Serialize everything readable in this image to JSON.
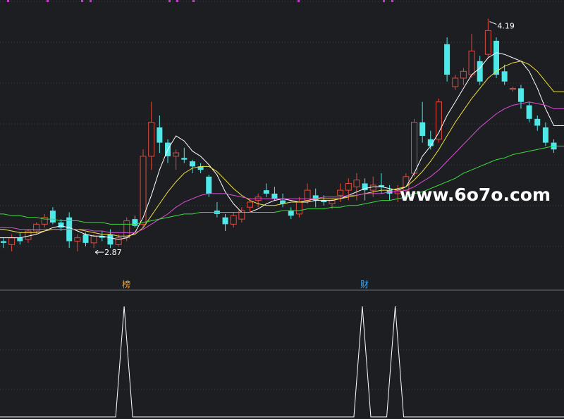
{
  "chart_data": [
    {
      "type": "candlestick",
      "title": "",
      "xlabel": "",
      "ylabel": "",
      "grid": true,
      "price_range": [
        2.6,
        4.3
      ],
      "series": [
        {
          "name": "",
          "kind": "ohlc",
          "values": [
            [
              2.88,
              2.9,
              2.84,
              2.87
            ],
            [
              2.86,
              2.92,
              2.82,
              2.9
            ],
            [
              2.9,
              2.93,
              2.86,
              2.88
            ],
            [
              2.89,
              2.95,
              2.87,
              2.94
            ],
            [
              2.94,
              2.99,
              2.92,
              2.98
            ],
            [
              2.98,
              3.04,
              2.96,
              3.02
            ],
            [
              3.06,
              3.08,
              2.98,
              2.99
            ],
            [
              2.99,
              3.01,
              2.94,
              2.96
            ],
            [
              3.02,
              3.05,
              2.84,
              2.88
            ],
            [
              2.88,
              2.92,
              2.82,
              2.9
            ],
            [
              2.92,
              2.93,
              2.85,
              2.87
            ],
            [
              2.87,
              2.92,
              2.84,
              2.91
            ],
            [
              2.91,
              2.94,
              2.88,
              2.9
            ],
            [
              2.92,
              2.95,
              2.84,
              2.86
            ],
            [
              2.86,
              2.92,
              2.85,
              2.9
            ],
            [
              2.9,
              3.02,
              2.88,
              3.0
            ],
            [
              3.01,
              3.03,
              2.96,
              2.97
            ],
            [
              2.98,
              3.42,
              2.96,
              3.38
            ],
            [
              3.38,
              3.7,
              3.3,
              3.58
            ],
            [
              3.55,
              3.62,
              3.4,
              3.46
            ],
            [
              3.46,
              3.48,
              3.34,
              3.38
            ],
            [
              3.38,
              3.42,
              3.3,
              3.4
            ],
            [
              3.37,
              3.43,
              3.34,
              3.36
            ],
            [
              3.35,
              3.36,
              3.28,
              3.32
            ],
            [
              3.32,
              3.34,
              3.28,
              3.3
            ],
            [
              3.26,
              3.27,
              3.14,
              3.16
            ],
            [
              3.06,
              3.11,
              3.02,
              3.04
            ],
            [
              3.02,
              3.04,
              2.94,
              2.98
            ],
            [
              2.98,
              3.05,
              2.96,
              3.03
            ],
            [
              3.01,
              3.08,
              2.99,
              3.06
            ],
            [
              3.08,
              3.13,
              3.05,
              3.11
            ],
            [
              3.12,
              3.16,
              3.08,
              3.14
            ],
            [
              3.18,
              3.22,
              3.14,
              3.16
            ],
            [
              3.16,
              3.2,
              3.12,
              3.13
            ],
            [
              3.12,
              3.16,
              3.08,
              3.1
            ],
            [
              3.06,
              3.08,
              3.01,
              3.03
            ],
            [
              3.04,
              3.14,
              3.02,
              3.11
            ],
            [
              3.12,
              3.22,
              3.1,
              3.18
            ],
            [
              3.15,
              3.19,
              3.08,
              3.12
            ],
            [
              3.12,
              3.15,
              3.09,
              3.11
            ],
            [
              3.1,
              3.13,
              3.07,
              3.12
            ],
            [
              3.15,
              3.22,
              3.11,
              3.18
            ],
            [
              3.18,
              3.25,
              3.12,
              3.22
            ],
            [
              3.2,
              3.28,
              3.12,
              3.24
            ],
            [
              3.22,
              3.25,
              3.12,
              3.18
            ],
            [
              3.18,
              3.26,
              3.14,
              3.21
            ],
            [
              3.21,
              3.28,
              3.16,
              3.2
            ],
            [
              3.18,
              3.21,
              3.12,
              3.16
            ],
            [
              3.16,
              3.21,
              3.11,
              3.18
            ],
            [
              3.18,
              3.28,
              3.16,
              3.26
            ],
            [
              3.28,
              3.6,
              3.26,
              3.58
            ],
            [
              3.58,
              3.7,
              3.46,
              3.5
            ],
            [
              3.48,
              3.53,
              3.42,
              3.44
            ],
            [
              3.48,
              3.72,
              3.46,
              3.7
            ],
            [
              4.04,
              4.08,
              3.82,
              3.86
            ],
            [
              3.79,
              3.86,
              3.77,
              3.84
            ],
            [
              3.84,
              3.9,
              3.8,
              3.88
            ],
            [
              3.86,
              4.1,
              3.84,
              4.0
            ],
            [
              3.94,
              3.97,
              3.8,
              3.82
            ],
            [
              3.98,
              4.19,
              3.96,
              4.12
            ],
            [
              4.06,
              4.08,
              3.84,
              3.86
            ],
            [
              3.88,
              3.92,
              3.8,
              3.82
            ],
            [
              3.78,
              3.79,
              3.76,
              3.78
            ],
            [
              3.78,
              3.8,
              3.66,
              3.7
            ],
            [
              3.68,
              3.7,
              3.58,
              3.6
            ],
            [
              3.6,
              3.62,
              3.53,
              3.56
            ],
            [
              3.55,
              3.58,
              3.44,
              3.46
            ],
            [
              3.46,
              3.48,
              3.4,
              3.42
            ]
          ]
        },
        {
          "name": "",
          "kind": "ma",
          "color": "#ffffff",
          "values": [
            2.9,
            2.9,
            2.9,
            2.91,
            2.92,
            2.94,
            2.96,
            2.97,
            2.96,
            2.94,
            2.92,
            2.91,
            2.91,
            2.9,
            2.89,
            2.9,
            2.93,
            3.02,
            3.15,
            3.3,
            3.42,
            3.5,
            3.47,
            3.41,
            3.38,
            3.33,
            3.27,
            3.17,
            3.1,
            3.05,
            3.05,
            3.07,
            3.1,
            3.12,
            3.13,
            3.12,
            3.11,
            3.11,
            3.12,
            3.12,
            3.12,
            3.13,
            3.15,
            3.17,
            3.19,
            3.2,
            3.2,
            3.19,
            3.18,
            3.2,
            3.28,
            3.38,
            3.44,
            3.52,
            3.62,
            3.7,
            3.78,
            3.86,
            3.9,
            3.96,
            3.99,
            3.98,
            3.96,
            3.94,
            3.88,
            3.78,
            3.66,
            3.56
          ]
        },
        {
          "name": "",
          "kind": "ma",
          "color": "#f0e03c",
          "values": [
            2.95,
            2.94,
            2.93,
            2.93,
            2.93,
            2.94,
            2.95,
            2.95,
            2.95,
            2.95,
            2.94,
            2.93,
            2.92,
            2.92,
            2.91,
            2.91,
            2.92,
            2.96,
            3.03,
            3.1,
            3.17,
            3.23,
            3.28,
            3.31,
            3.32,
            3.32,
            3.29,
            3.24,
            3.19,
            3.15,
            3.12,
            3.1,
            3.09,
            3.09,
            3.1,
            3.11,
            3.11,
            3.12,
            3.13,
            3.13,
            3.13,
            3.13,
            3.14,
            3.15,
            3.16,
            3.17,
            3.18,
            3.18,
            3.19,
            3.2,
            3.24,
            3.29,
            3.35,
            3.42,
            3.5,
            3.58,
            3.65,
            3.72,
            3.78,
            3.84,
            3.88,
            3.91,
            3.93,
            3.94,
            3.92,
            3.88,
            3.82,
            3.76
          ]
        },
        {
          "name": "",
          "kind": "ma",
          "color": "#d94fd4",
          "values": [
            2.96,
            2.96,
            2.95,
            2.95,
            2.95,
            2.95,
            2.95,
            2.95,
            2.95,
            2.95,
            2.95,
            2.94,
            2.94,
            2.93,
            2.93,
            2.93,
            2.93,
            2.95,
            2.98,
            3.01,
            3.04,
            3.08,
            3.11,
            3.13,
            3.15,
            3.16,
            3.16,
            3.16,
            3.15,
            3.14,
            3.13,
            3.13,
            3.13,
            3.13,
            3.13,
            3.13,
            3.13,
            3.13,
            3.13,
            3.14,
            3.14,
            3.14,
            3.15,
            3.15,
            3.16,
            3.16,
            3.16,
            3.17,
            3.17,
            3.18,
            3.2,
            3.23,
            3.26,
            3.3,
            3.35,
            3.4,
            3.45,
            3.5,
            3.55,
            3.59,
            3.63,
            3.66,
            3.68,
            3.69,
            3.7,
            3.69,
            3.68,
            3.66
          ]
        },
        {
          "name": "",
          "kind": "ma",
          "color": "#3cdc3c",
          "values": [
            3.04,
            3.03,
            3.03,
            3.02,
            3.02,
            3.01,
            3.01,
            3.0,
            3.0,
            3.0,
            2.99,
            2.99,
            2.99,
            2.98,
            2.98,
            2.98,
            2.98,
            2.99,
            3.0,
            3.01,
            3.02,
            3.03,
            3.04,
            3.04,
            3.05,
            3.05,
            3.05,
            3.05,
            3.05,
            3.05,
            3.05,
            3.05,
            3.05,
            3.05,
            3.06,
            3.06,
            3.06,
            3.07,
            3.07,
            3.07,
            3.08,
            3.08,
            3.09,
            3.09,
            3.1,
            3.11,
            3.12,
            3.12,
            3.13,
            3.14,
            3.16,
            3.17,
            3.19,
            3.21,
            3.23,
            3.25,
            3.28,
            3.3,
            3.32,
            3.34,
            3.36,
            3.37,
            3.39,
            3.4,
            3.41,
            3.42,
            3.43,
            3.44
          ]
        }
      ],
      "annotations": [
        {
          "label": "2.87",
          "kind": "low",
          "index": 11
        },
        {
          "label": "4.19",
          "kind": "high",
          "index": 59
        },
        {
          "label": "榜",
          "kind": "event",
          "index": 14
        },
        {
          "label": "财",
          "kind": "event",
          "index": 43
        }
      ],
      "watermark": "www.6o7o.com"
    },
    {
      "type": "line",
      "title": "",
      "xlabel": "",
      "ylabel": "",
      "ylim": [
        0,
        1
      ],
      "series": [
        {
          "name": "",
          "color": "#ffffff",
          "values": [
            0,
            0,
            0,
            0,
            0,
            0,
            0,
            0,
            0,
            0,
            0,
            0,
            0,
            0,
            1,
            0,
            0,
            0,
            0,
            0,
            0,
            0,
            0,
            0,
            0,
            0,
            0,
            0,
            0,
            0,
            0,
            0,
            0,
            0,
            0,
            0,
            0,
            0,
            0,
            0,
            0,
            0,
            0,
            1,
            0,
            0,
            0,
            1,
            0,
            0,
            0,
            0,
            0,
            0,
            0,
            0,
            0,
            0,
            0,
            0,
            0,
            0,
            0,
            0,
            0,
            0,
            0,
            0
          ]
        }
      ]
    }
  ],
  "colors": {
    "background": "#1d1e22",
    "up": "#e04a3c",
    "down": "#4ee8e8",
    "grid": "#3a3d44",
    "divider": "#6a6d74",
    "label": "#ffffff",
    "event_orange": "#f0a030",
    "event_blue": "#4aa8f0",
    "marker": "#c044c8"
  }
}
